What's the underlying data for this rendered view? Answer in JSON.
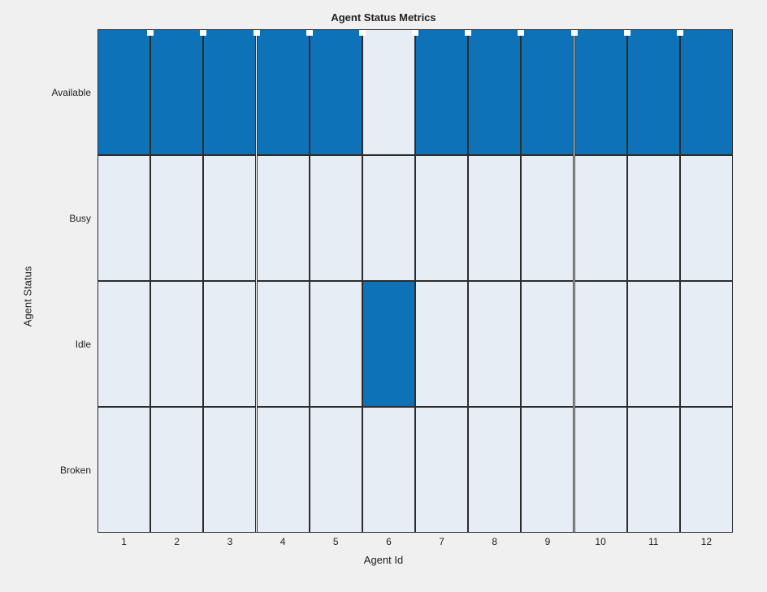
{
  "chart_data": {
    "type": "heatmap",
    "title": "Agent Status Metrics",
    "xlabel": "Agent Id",
    "ylabel": "Agent Status",
    "x_categories": [
      "1",
      "2",
      "3",
      "4",
      "5",
      "6",
      "7",
      "8",
      "9",
      "10",
      "11",
      "12"
    ],
    "y_categories": [
      "Available",
      "Busy",
      "Idle",
      "Broken"
    ],
    "matrix": [
      [
        1,
        1,
        1,
        1,
        1,
        0,
        1,
        1,
        1,
        1,
        1,
        1
      ],
      [
        0,
        0,
        0,
        0,
        0,
        0,
        0,
        0,
        0,
        0,
        0,
        0
      ],
      [
        0,
        0,
        0,
        0,
        0,
        1,
        0,
        0,
        0,
        0,
        0,
        0
      ],
      [
        0,
        0,
        0,
        0,
        0,
        0,
        0,
        0,
        0,
        0,
        0,
        0
      ]
    ],
    "colors": {
      "low": "#E6EDF5",
      "high": "#0E72B8"
    }
  }
}
